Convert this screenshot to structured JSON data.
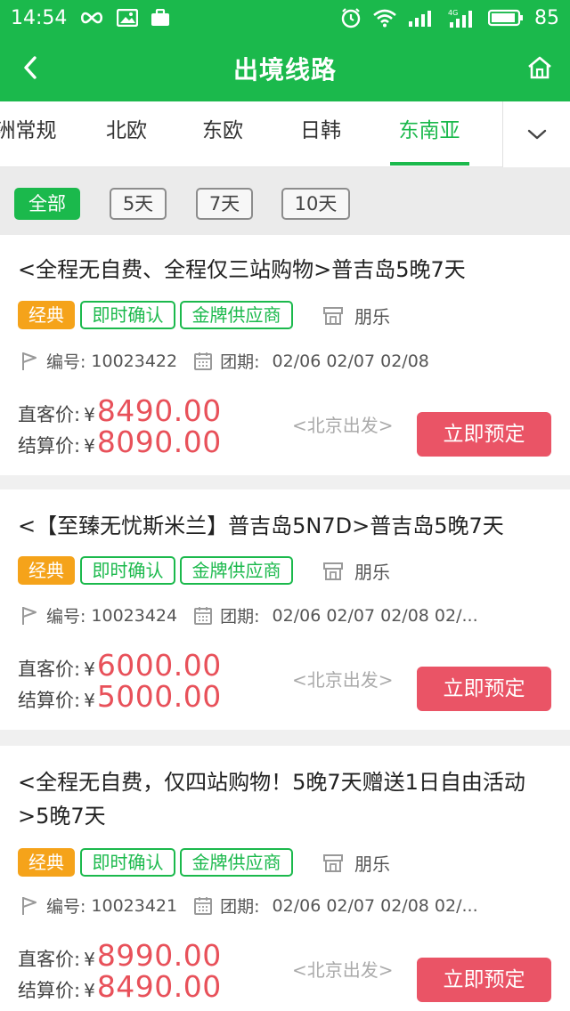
{
  "status_bar": {
    "time": "14:54",
    "battery": "85"
  },
  "nav": {
    "title": "出境线路"
  },
  "tabs": [
    {
      "label": "洲常规",
      "active": false
    },
    {
      "label": "北欧",
      "active": false
    },
    {
      "label": "东欧",
      "active": false
    },
    {
      "label": "日韩",
      "active": false
    },
    {
      "label": "东南亚",
      "active": true
    }
  ],
  "filters": [
    {
      "label": "全部",
      "active": true
    },
    {
      "label": "5天",
      "active": false
    },
    {
      "label": "7天",
      "active": false
    },
    {
      "label": "10天",
      "active": false
    }
  ],
  "colors": {
    "brand_green": "#1bb94c",
    "price_red": "#e8515a",
    "button_red": "#ea5466",
    "tag_orange": "#f5a31a"
  },
  "products": [
    {
      "title": "<全程无自费、全程仅三站购物>普吉岛5晚7天",
      "tags": [
        "经典",
        "即时确认",
        "金牌供应商"
      ],
      "supplier": "朋乐",
      "code_label": "编号:",
      "code": "10023422",
      "dates_label": "团期:",
      "dates": "02/06 02/07 02/08",
      "direct_label": "直客价:",
      "currency": "¥",
      "direct_price": "8490.00",
      "settle_label": "结算价:",
      "settle_price": "8090.00",
      "departure": "<北京出发>",
      "button": "立即预定"
    },
    {
      "title": "<【至臻无忧斯米兰】普吉岛5N7D>普吉岛5晚7天",
      "tags": [
        "经典",
        "即时确认",
        "金牌供应商"
      ],
      "supplier": "朋乐",
      "code_label": "编号:",
      "code": "10023424",
      "dates_label": "团期:",
      "dates": "02/06 02/07 02/08 02/...",
      "direct_label": "直客价:",
      "currency": "¥",
      "direct_price": "6000.00",
      "settle_label": "结算价:",
      "settle_price": "5000.00",
      "departure": "<北京出发>",
      "button": "立即预定"
    },
    {
      "title": "<全程无自费，仅四站购物！5晚7天赠送1日自由活动>5晚7天",
      "tags": [
        "经典",
        "即时确认",
        "金牌供应商"
      ],
      "supplier": "朋乐",
      "code_label": "编号:",
      "code": "10023421",
      "dates_label": "团期:",
      "dates": "02/06 02/07 02/08 02/...",
      "direct_label": "直客价:",
      "currency": "¥",
      "direct_price": "8990.00",
      "settle_label": "结算价:",
      "settle_price": "8490.00",
      "departure": "<北京出发>",
      "button": "立即预定"
    }
  ]
}
